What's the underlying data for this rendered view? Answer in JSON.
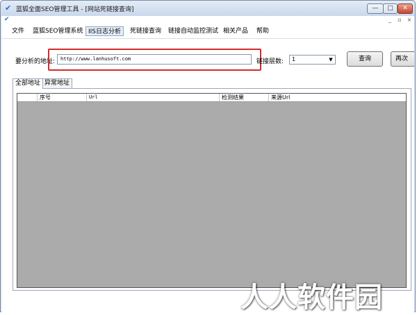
{
  "window": {
    "title": "蓝狐全面SEO管理工具 - [网站死链接查询]",
    "controls": {
      "minimize": "—",
      "maximize": "□",
      "close": "✕"
    },
    "mdi_controls": {
      "minimize": "_",
      "restore": "▫",
      "close": "×"
    }
  },
  "menu": {
    "items": [
      {
        "label": "文件"
      },
      {
        "label": "蓝狐SEO管理系统"
      },
      {
        "label": "IIS日志分析"
      },
      {
        "label": "死链接查询"
      },
      {
        "label": "链接自动监控测试"
      },
      {
        "label": "相关产品"
      },
      {
        "label": "帮助"
      }
    ],
    "active_index": 2
  },
  "form": {
    "address_label": "要分析的地址:",
    "address_value": "http://www.lanhusoft.com",
    "depth_label": "链接层数:",
    "depth_value": "1",
    "query_button": "查询",
    "again_button": "再次"
  },
  "tabs": [
    {
      "label": "全部地址"
    },
    {
      "label": "异常地址"
    }
  ],
  "table": {
    "columns": [
      "",
      "序号",
      "Url",
      "检测结果",
      "来源Url"
    ]
  },
  "watermark": "人人软件园",
  "colors": {
    "highlight": "#d62a2a",
    "grid_bg": "#ababab",
    "accent": "#2a6bd1"
  }
}
